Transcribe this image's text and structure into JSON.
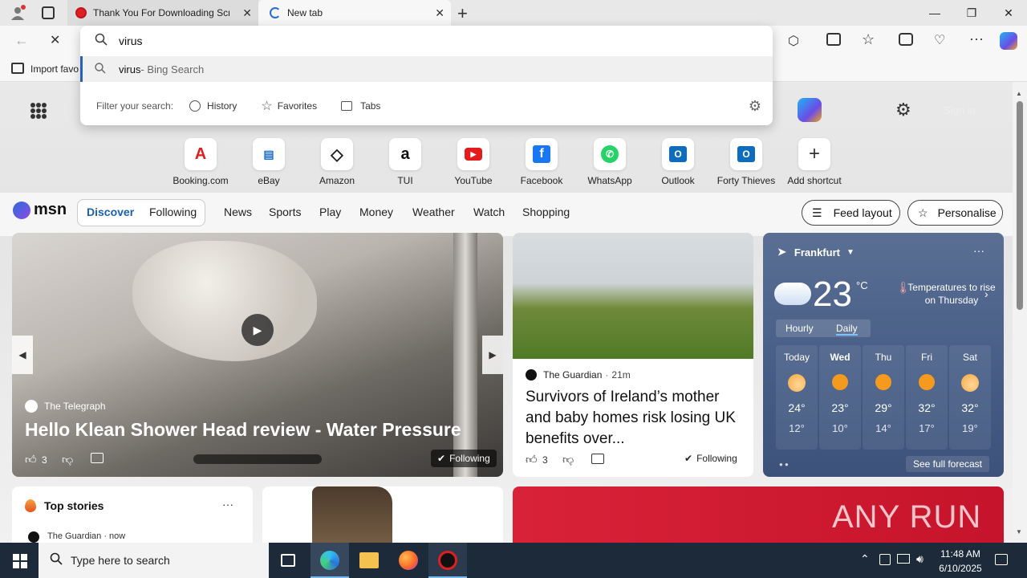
{
  "browser": {
    "tabs": [
      {
        "title": "Thank You For Downloading Scre"
      },
      {
        "title": "New tab"
      }
    ],
    "omnibox": {
      "value": "virus",
      "suggestion_term": "virus",
      "suggestion_suffix": " - Bing Search",
      "filter_label": "Filter your search:",
      "filters": [
        "History",
        "Favorites",
        "Tabs"
      ]
    },
    "bookmarks": {
      "import_label": "Import favo"
    },
    "signin_label": "Sign in"
  },
  "shortcuts": [
    "Booking.com",
    "eBay",
    "Amazon",
    "TUI",
    "YouTube",
    "Facebook",
    "WhatsApp",
    "Outlook",
    "Forty Thieves",
    "Add shortcut"
  ],
  "msn": {
    "logo": "msn",
    "tabs": [
      "Discover",
      "Following"
    ],
    "nav": [
      "News",
      "Sports",
      "Play",
      "Money",
      "Weather",
      "Watch",
      "Shopping"
    ],
    "feed_layout": "Feed layout",
    "personalise": "Personalise"
  },
  "hero": {
    "source": "The Telegraph",
    "title": "Hello Klean Shower Head review - Water Pressure",
    "likes": "3",
    "following": "Following"
  },
  "story2": {
    "source": "The Guardian",
    "time": "21m",
    "title": "Survivors of Ireland’s mother and baby homes risk losing UK benefits over...",
    "likes": "3",
    "following": "Following"
  },
  "weather": {
    "location": "Frankfurt",
    "temp": "23",
    "unit": "°C",
    "note": "Temperatures to rise on Thursday",
    "toggle": [
      "Hourly",
      "Daily"
    ],
    "days": [
      {
        "name": "Today",
        "hi": "24°",
        "lo": "12°"
      },
      {
        "name": "Wed",
        "hi": "23°",
        "lo": "10°"
      },
      {
        "name": "Thu",
        "hi": "29°",
        "lo": "14°"
      },
      {
        "name": "Fri",
        "hi": "32°",
        "lo": "17°"
      },
      {
        "name": "Sat",
        "hi": "32°",
        "lo": "19°"
      }
    ],
    "forecast_link": "See full forecast"
  },
  "top_stories": {
    "title": "Top stories",
    "first_source": "The Guardian · now"
  },
  "ad": {
    "brand": "ANY RUN"
  },
  "taskbar": {
    "search_placeholder": "Type here to search",
    "time": "11:48 AM",
    "date": "6/10/2025"
  }
}
